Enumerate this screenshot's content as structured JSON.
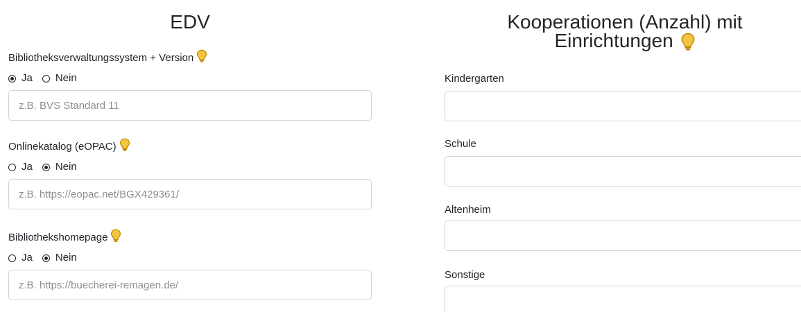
{
  "edv": {
    "title": "EDV",
    "fields": [
      {
        "label": "Bibliotheksverwaltungssystem + Version",
        "yes_label": "Ja",
        "no_label": "Nein",
        "selected": "Ja",
        "placeholder": "z.B. BVS Standard 11"
      },
      {
        "label": "Onlinekatalog (eOPAC)",
        "yes_label": "Ja",
        "no_label": "Nein",
        "selected": "Nein",
        "placeholder": "z.B. https://eopac.net/BGX429361/"
      },
      {
        "label": "Bibliothekshomepage",
        "yes_label": "Ja",
        "no_label": "Nein",
        "selected": "Nein",
        "placeholder": "z.B. https://buecherei-remagen.de/"
      }
    ]
  },
  "kooperationen": {
    "title_line1": "Kooperationen (Anzahl) mit",
    "title_line2": "Einrichtungen",
    "fields": [
      {
        "label": "Kindergarten"
      },
      {
        "label": "Schule"
      },
      {
        "label": "Altenheim"
      },
      {
        "label": "Sonstige"
      }
    ]
  },
  "icons": {
    "info": "lightbulb-icon",
    "bulb_color": "#f5c542",
    "bulb_outline": "#c08a00"
  }
}
